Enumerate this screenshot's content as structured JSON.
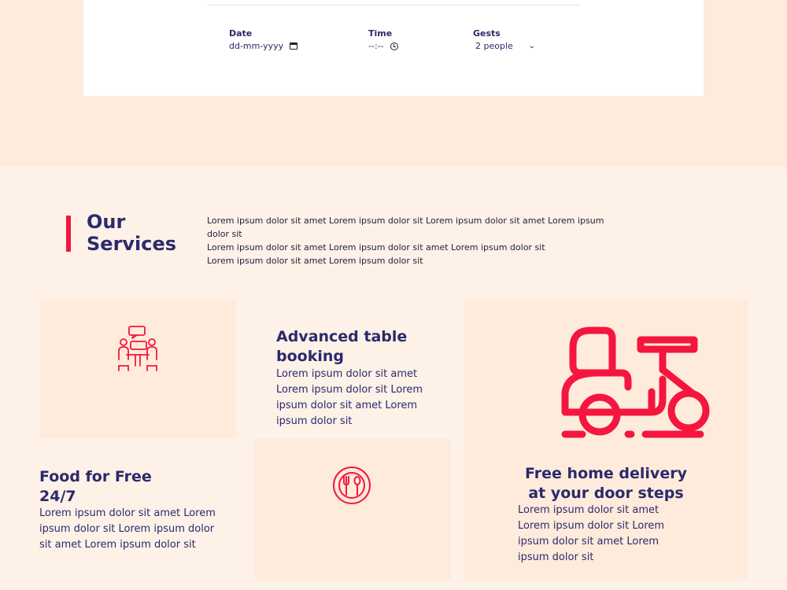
{
  "booking": {
    "date_label": "Date",
    "date_value": "dd-mm-yyyy",
    "time_label": "Time",
    "time_value": "--:--",
    "guests_label": "Gests",
    "guests_value": "2 people"
  },
  "services": {
    "title_line1": "Our",
    "title_line2": "Services",
    "description_line1": "Lorem ipsum dolor sit amet Lorem ipsum dolor sit Lorem ipsum dolor sit amet Lorem ipsum dolor sit",
    "description_line2": "Lorem ipsum dolor sit amet Lorem ipsum dolor sit amet Lorem ipsum dolor sit",
    "description_line3": "Lorem ipsum dolor sit amet Lorem ipsum dolor sit",
    "items": [
      {
        "title_line1": "Advanced table",
        "title_line2": "booking",
        "text": "Lorem ipsum dolor sit amet Lorem ipsum dolor sit Lorem ipsum dolor sit amet Lorem ipsum dolor sit",
        "icon": "meeting-table-icon"
      },
      {
        "title_line1": "Food for Free",
        "title_line2": "24/7",
        "text": "Lorem ipsum dolor sit amet Lorem ipsum dolor sit Lorem ipsum dolor sit amet Lorem ipsum dolor sit",
        "icon": "plate-cutlery-icon"
      },
      {
        "title_line1": "Free home delivery",
        "title_line2": "at your door steps",
        "text": "Lorem ipsum dolor sit amet Lorem ipsum dolor sit Lorem ipsum dolor sit amet Lorem ipsum dolor sit",
        "icon": "delivery-scooter-icon"
      }
    ]
  },
  "colors": {
    "accent": "#f5163f",
    "heading": "#2a2a6c",
    "tile": "#ffebdc",
    "background": "#fdf1e8"
  }
}
